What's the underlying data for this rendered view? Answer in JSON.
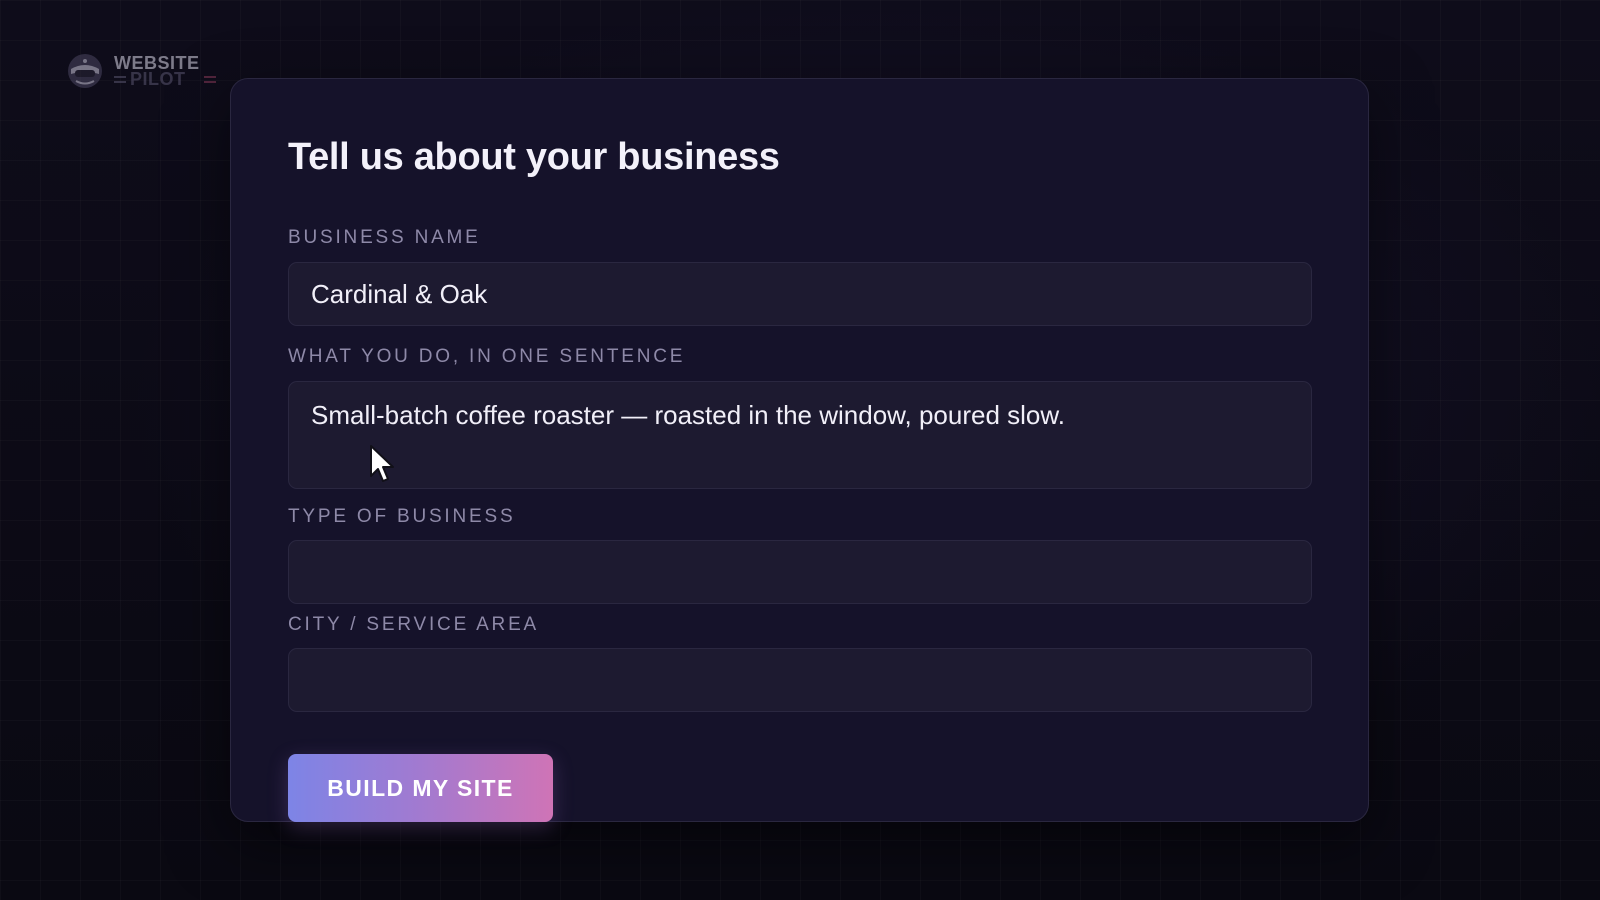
{
  "logo": {
    "line1": "WEBSITE",
    "line2": "PILOT"
  },
  "form": {
    "title": "Tell us about your business",
    "fields": [
      {
        "label": "BUSINESS NAME",
        "value": "Cardinal & Oak"
      },
      {
        "label": "WHAT YOU DO, IN ONE SENTENCE",
        "value": "Small-batch coffee roaster — roasted in the window, poured slow."
      },
      {
        "label": "TYPE OF BUSINESS",
        "value": ""
      },
      {
        "label": "CITY / SERVICE AREA",
        "value": ""
      }
    ],
    "submit_label": "BUILD MY SITE"
  },
  "colors": {
    "background": "#0a0912",
    "card": "#15122a",
    "field": "#1d1a30",
    "label": "#8e89a8",
    "button_gradient_start": "#7d84e6",
    "button_gradient_end": "#cf74b6"
  },
  "icons": {
    "logo": "pilot-helmet-icon",
    "cursor": "mouse-pointer-icon"
  }
}
